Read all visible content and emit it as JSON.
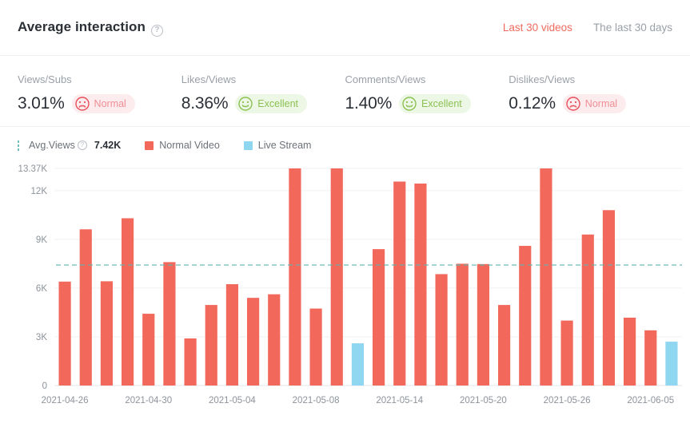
{
  "header": {
    "title": "Average interaction",
    "help_icon": "question-mark-icon",
    "tabs": [
      {
        "label": "Last 30 videos",
        "active": true
      },
      {
        "label": "The last 30 days",
        "active": false
      }
    ]
  },
  "metrics": [
    {
      "label": "Views/Subs",
      "value": "3.01%",
      "badge": "Normal",
      "badge_type": "normal",
      "face": "sad-face-icon"
    },
    {
      "label": "Likes/Views",
      "value": "8.36%",
      "badge": "Excellent",
      "badge_type": "excellent",
      "face": "smiley-face-icon"
    },
    {
      "label": "Comments/Views",
      "value": "1.40%",
      "badge": "Excellent",
      "badge_type": "excellent",
      "face": "smiley-face-icon"
    },
    {
      "label": "Dislikes/Views",
      "value": "0.12%",
      "badge": "Normal",
      "badge_type": "normal",
      "face": "sad-face-icon"
    }
  ],
  "legend": {
    "avg_label": "Avg.Views",
    "avg_value": "7.42K",
    "items": [
      {
        "label": "Normal Video",
        "color": "#f2695c"
      },
      {
        "label": "Live Stream",
        "color": "#8fd6f0"
      }
    ]
  },
  "colors": {
    "normal_video": "#f2695c",
    "live_stream": "#8fd6f0",
    "avg_line": "#5fb3ad",
    "grid": "#f0f1f3",
    "accent": "#f06a5d",
    "good": "#8cc152"
  },
  "chart_data": {
    "type": "bar",
    "title": "Average interaction",
    "xlabel": "",
    "ylabel": "",
    "ylim": [
      0,
      13370
    ],
    "ytick_labels": [
      "0",
      "3K",
      "6K",
      "9K",
      "12K",
      "13.37K"
    ],
    "ytick_values": [
      0,
      3000,
      6000,
      9000,
      12000,
      13370
    ],
    "grid": true,
    "legend_position": "top-left",
    "average_line": {
      "label": "Avg.Views",
      "value": 7420,
      "display": "7.42K",
      "style": "dashed",
      "color": "#5fb3ad"
    },
    "xtick_labels": [
      "2021-04-26",
      "2021-04-30",
      "2021-05-04",
      "2021-05-08",
      "2021-05-14",
      "2021-05-20",
      "2021-05-26",
      "2021-06-05"
    ],
    "xtick_indices": [
      0,
      4,
      8,
      12,
      16,
      20,
      24,
      28
    ],
    "series": [
      {
        "name": "Normal Video",
        "color": "#f2695c"
      },
      {
        "name": "Live Stream",
        "color": "#8fd6f0"
      }
    ],
    "bars": [
      {
        "index": 0,
        "value": 6400,
        "type": "Normal Video"
      },
      {
        "index": 1,
        "value": 9620,
        "type": "Normal Video"
      },
      {
        "index": 2,
        "value": 6420,
        "type": "Normal Video"
      },
      {
        "index": 3,
        "value": 10300,
        "type": "Normal Video"
      },
      {
        "index": 4,
        "value": 4420,
        "type": "Normal Video"
      },
      {
        "index": 5,
        "value": 7600,
        "type": "Normal Video"
      },
      {
        "index": 6,
        "value": 2900,
        "type": "Normal Video"
      },
      {
        "index": 7,
        "value": 4960,
        "type": "Normal Video"
      },
      {
        "index": 8,
        "value": 6240,
        "type": "Normal Video"
      },
      {
        "index": 9,
        "value": 5400,
        "type": "Normal Video"
      },
      {
        "index": 10,
        "value": 5620,
        "type": "Normal Video"
      },
      {
        "index": 11,
        "value": 13370,
        "type": "Normal Video"
      },
      {
        "index": 12,
        "value": 4740,
        "type": "Normal Video"
      },
      {
        "index": 13,
        "value": 13370,
        "type": "Normal Video"
      },
      {
        "index": 14,
        "value": 2600,
        "type": "Live Stream"
      },
      {
        "index": 15,
        "value": 8400,
        "type": "Normal Video"
      },
      {
        "index": 16,
        "value": 12560,
        "type": "Normal Video"
      },
      {
        "index": 17,
        "value": 12440,
        "type": "Normal Video"
      },
      {
        "index": 18,
        "value": 6860,
        "type": "Normal Video"
      },
      {
        "index": 19,
        "value": 7500,
        "type": "Normal Video"
      },
      {
        "index": 20,
        "value": 7480,
        "type": "Normal Video"
      },
      {
        "index": 21,
        "value": 4960,
        "type": "Normal Video"
      },
      {
        "index": 22,
        "value": 8600,
        "type": "Normal Video"
      },
      {
        "index": 23,
        "value": 13370,
        "type": "Normal Video"
      },
      {
        "index": 24,
        "value": 4000,
        "type": "Normal Video"
      },
      {
        "index": 25,
        "value": 9300,
        "type": "Normal Video"
      },
      {
        "index": 26,
        "value": 10800,
        "type": "Normal Video"
      },
      {
        "index": 27,
        "value": 4180,
        "type": "Normal Video"
      },
      {
        "index": 28,
        "value": 3400,
        "type": "Normal Video"
      },
      {
        "index": 29,
        "value": 2700,
        "type": "Live Stream"
      }
    ]
  }
}
